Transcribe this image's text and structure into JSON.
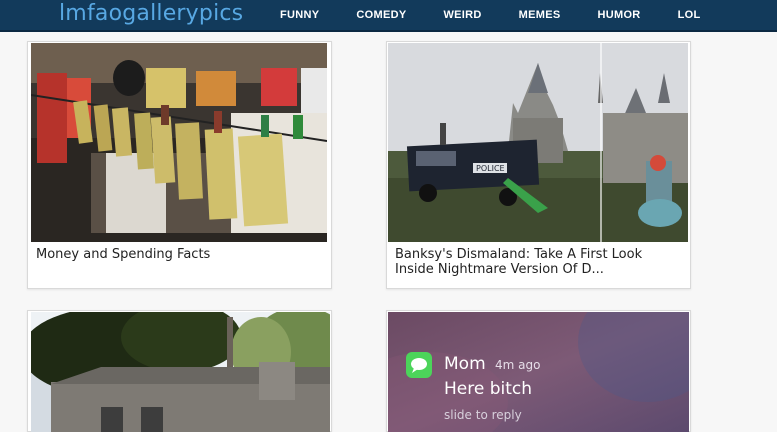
{
  "site": {
    "logo": "lmfaogallerypics",
    "nav": [
      {
        "label": "FUNNY"
      },
      {
        "label": "COMEDY"
      },
      {
        "label": "WEIRD"
      },
      {
        "label": "MEMES"
      },
      {
        "label": "HUMOR"
      },
      {
        "label": "LOL"
      }
    ]
  },
  "posts": [
    {
      "title": "Money and Spending Facts"
    },
    {
      "title": "Banksy's Dismaland: Take A First Look Inside Nightmare Version Of D..."
    },
    {
      "title": ""
    },
    {
      "title": "",
      "notification": {
        "sender": "Mom",
        "time": "4m ago",
        "message": "Here bitch",
        "action": "slide to reply"
      }
    }
  ],
  "colors": {
    "header_bg": "#123a5b",
    "logo": "#58a8e3",
    "nav_text": "#ffffff",
    "page_bg": "#f7f7f7"
  }
}
